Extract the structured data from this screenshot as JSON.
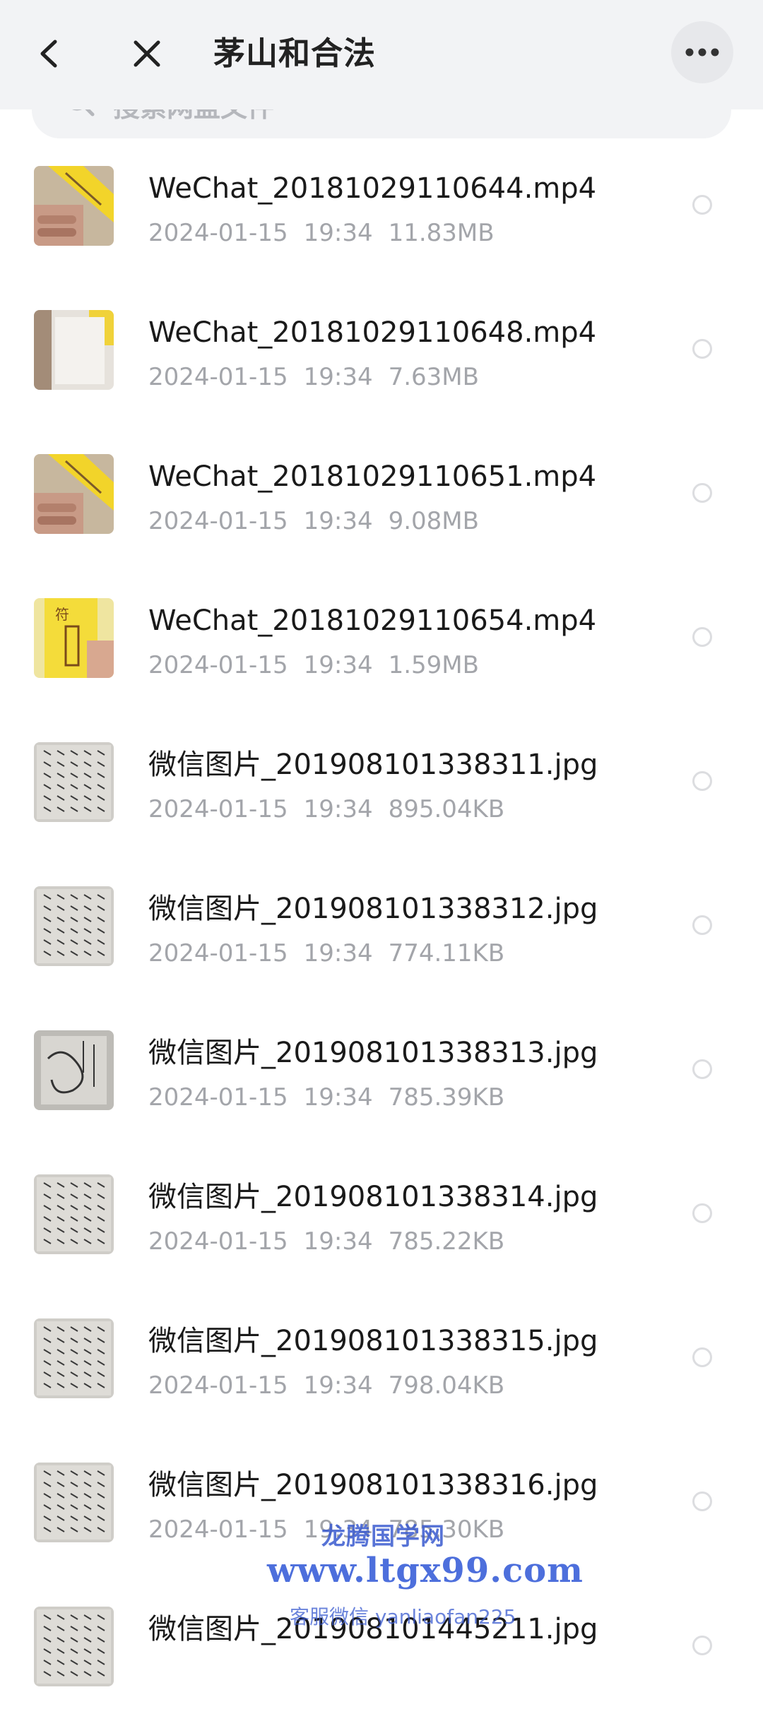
{
  "header": {
    "title": "茅山和合法",
    "back_icon": "chevron-left-icon",
    "close_icon": "close-icon",
    "more_icon": "more-horizontal-icon"
  },
  "search": {
    "placeholder": "搜索网盘文件"
  },
  "files": [
    {
      "name": "WeChat_20181029110644.mp4",
      "date": "2024-01-15",
      "time": "19:34",
      "size": "11.83MB",
      "thumb": "video-yellow-paper"
    },
    {
      "name": "WeChat_20181029110648.mp4",
      "date": "2024-01-15",
      "time": "19:34",
      "size": "7.63MB",
      "thumb": "video-white-paper"
    },
    {
      "name": "WeChat_20181029110651.mp4",
      "date": "2024-01-15",
      "time": "19:34",
      "size": "9.08MB",
      "thumb": "video-yellow-paper"
    },
    {
      "name": "WeChat_20181029110654.mp4",
      "date": "2024-01-15",
      "time": "19:34",
      "size": "1.59MB",
      "thumb": "video-yellow-talisman"
    },
    {
      "name": "微信图片_201908101338311.jpg",
      "date": "2024-01-15",
      "time": "19:34",
      "size": "895.04KB",
      "thumb": "image-handwritten"
    },
    {
      "name": "微信图片_201908101338312.jpg",
      "date": "2024-01-15",
      "time": "19:34",
      "size": "774.11KB",
      "thumb": "image-handwritten"
    },
    {
      "name": "微信图片_201908101338313.jpg",
      "date": "2024-01-15",
      "time": "19:34",
      "size": "785.39KB",
      "thumb": "image-drawing"
    },
    {
      "name": "微信图片_201908101338314.jpg",
      "date": "2024-01-15",
      "time": "19:34",
      "size": "785.22KB",
      "thumb": "image-handwritten"
    },
    {
      "name": "微信图片_201908101338315.jpg",
      "date": "2024-01-15",
      "time": "19:34",
      "size": "798.04KB",
      "thumb": "image-handwritten"
    },
    {
      "name": "微信图片_201908101338316.jpg",
      "date": "2024-01-15",
      "time": "19:34",
      "size": "785.30KB",
      "thumb": "image-handwritten"
    },
    {
      "name": "微信图片_201908101445211.jpg",
      "date": "",
      "time": "",
      "size": "",
      "thumb": "image-handwritten"
    }
  ],
  "watermark": {
    "line1": "龙腾国学网",
    "line2": "www.ltgx99.com",
    "line3": "客服微信 yanliaofan225"
  }
}
